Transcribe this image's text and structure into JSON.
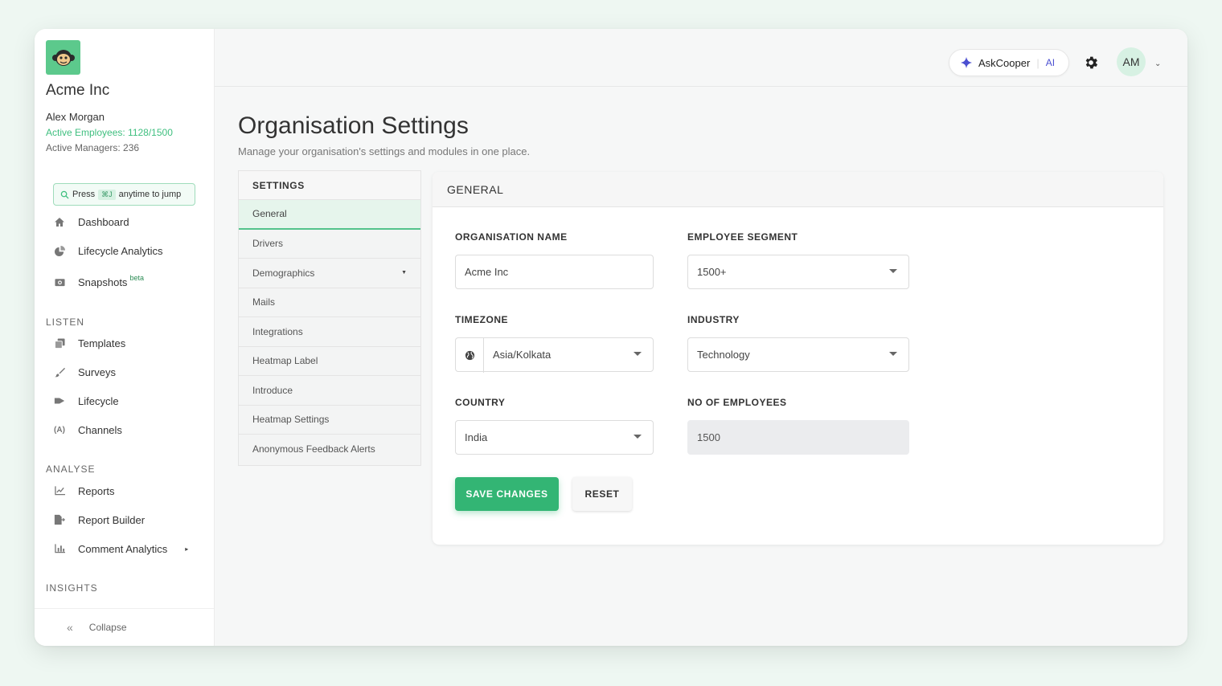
{
  "sidebar": {
    "company": "Acme Inc",
    "user": "Alex Morgan",
    "active_employees": "Active Employees: 1128/1500",
    "active_managers": "Active Managers: 236",
    "jump": {
      "press": "Press",
      "shortcut": "⌘J",
      "suffix": "anytime to jump"
    },
    "items": [
      {
        "label": "Dashboard",
        "icon": "home-icon"
      },
      {
        "label": "Lifecycle Analytics",
        "icon": "pie-chart-icon"
      },
      {
        "label": "Snapshots",
        "icon": "camera-icon",
        "badge": "beta"
      }
    ],
    "listen": {
      "label": "LISTEN",
      "items": [
        {
          "label": "Templates",
          "icon": "copy-icon"
        },
        {
          "label": "Surveys",
          "icon": "brush-icon"
        },
        {
          "label": "Lifecycle",
          "icon": "flag-icon"
        },
        {
          "label": "Channels",
          "icon": "broadcast-icon"
        }
      ]
    },
    "analyse": {
      "label": "ANALYSE",
      "items": [
        {
          "label": "Reports",
          "icon": "line-chart-icon"
        },
        {
          "label": "Report Builder",
          "icon": "file-export-icon"
        },
        {
          "label": "Comment Analytics",
          "icon": "bar-chart-icon"
        }
      ]
    },
    "insights": {
      "label": "INSIGHTS"
    },
    "collapse": "Collapse"
  },
  "topbar": {
    "ask": "AskCooper",
    "ai": "AI",
    "avatar": "AM"
  },
  "page": {
    "title": "Organisation Settings",
    "subtitle": "Manage your organisation's settings and modules in one place."
  },
  "settings_menu": {
    "heading": "SETTINGS",
    "items": [
      "General",
      "Drivers",
      "Demographics",
      "Mails",
      "Integrations",
      "Heatmap Label",
      "Introduce",
      "Heatmap Settings",
      "Anonymous Feedback Alerts"
    ]
  },
  "general": {
    "heading": "GENERAL",
    "org_name": {
      "label": "ORGANISATION NAME",
      "value": "Acme Inc"
    },
    "segment": {
      "label": "EMPLOYEE SEGMENT",
      "value": "1500+"
    },
    "timezone": {
      "label": "TIMEZONE",
      "value": "Asia/Kolkata"
    },
    "industry": {
      "label": "INDUSTRY",
      "value": "Technology"
    },
    "country": {
      "label": "COUNTRY",
      "value": "India"
    },
    "employees": {
      "label": "NO OF EMPLOYEES",
      "value": "1500"
    },
    "save": "SAVE CHANGES",
    "reset": "RESET"
  },
  "colors": {
    "accent": "#33b574",
    "ai": "#4b4fd1"
  }
}
